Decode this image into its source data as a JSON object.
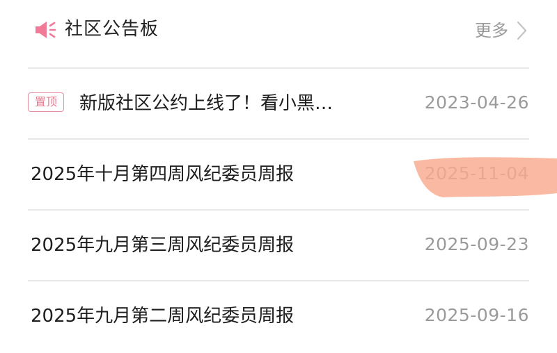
{
  "header": {
    "title": "社区公告板",
    "more_label": "更多",
    "icon": "megaphone-icon",
    "accent_color": "#f07a98"
  },
  "notices": [
    {
      "badge": "置顶",
      "title": "新版社区公约上线了！看小黑…",
      "date": "2023-04-26"
    },
    {
      "title": "2025年十月第四周风纪委员周报",
      "date": "2025-11-04"
    },
    {
      "title": "2025年九月第三周风纪委员周报",
      "date": "2025-09-23"
    },
    {
      "title": "2025年九月第二周风纪委员周报",
      "date": "2025-09-16"
    }
  ],
  "colors": {
    "badge_border": "#e58fa2",
    "date_text": "#9a9a9a",
    "highlight_mark": "#f9a98e"
  }
}
